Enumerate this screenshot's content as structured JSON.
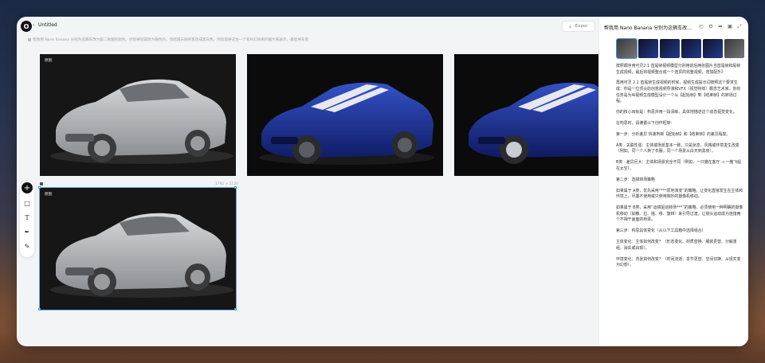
{
  "app": {
    "logo_text": "O",
    "doc_title": "Untitled",
    "export_label": "Expor",
    "prompt_text": "帮我用 Nano Banana 分别为这辆车改为第二张图的颜色，然后将轮毂改为银色的，然后再去除背景改成黑白色，然后再将这台一个有科幻效果的图片来表示，最后将车变"
  },
  "canvas": {
    "frame1_tag": "原图",
    "frame4_tag": "原图",
    "frame4_dims": "1792 × 1120"
  },
  "colors": {
    "accent": "#4a90e2",
    "car_gray": "#b9bcc0",
    "car_blue": "#1e3aa8"
  },
  "toolbar": {
    "tools": [
      "plus-icon",
      "square-icon",
      "text-icon",
      "pen-icon",
      "pencil-icon"
    ]
  },
  "panel": {
    "title": "帮我用 Nano Banana 分别为这辆车改为...",
    "icons": [
      "history-icon",
      "gear-icon",
      "share-icon",
      "image-icon",
      "collapse-icon"
    ],
    "paragraphs": [
      "按照顺序用可灵2.1 首尾帧视频模型分别用前后两张图片当首尾帧和尾帧生成视频，最后将视频整合成一个连贯的完整视频，增加配乐》",
      "再用可灵 2.1 首尾帧生成视频的时候，视频生成提示词按照这个要求生成：你是一位顶尖的创意视频导演和VFX（视觉特效）概念艺术家。你的任务是为AI视频生成模型设计一个从【起始帧】到【结束帧】的转场过程。",
      "你的核心目标是：构思并用一段清晰、具体地描述这个动态视觉变化。",
      "在构思时，请遵循以下创作框架：",
      "第一步：分析差异 快速判断【起始帧】和【结束帧】的差异程度。",
      "A类 · 关联性强：主体或场景基本一致，只是状态、风格或环境发生改变（例如，同一个人换了衣服，同一个场景从白天到黑夜）。",
      "B类 · 差异巨大：主体和场景完全不同（例如，一只猫在客厅 → 一艘飞船在太空）。",
      "第二步：选择转场策略",
      "如果属于 A类，优先采用“***原地演变”的策略。让变化直接发生在主体和环境上，尽量不使用或只使用微妙的摄像机移动。",
      "如果属于 B类，采用“运镜驱动转场***”的策略。必须使用一种明确的摄像机移动（如推、拉、摇、移、旋转）来引导过渡，让镜头运动成为连接两个不相干画面的桥梁。",
      "第三步：构思具体变化（从以下工具箱中选择组合）",
      "主体变化：主体如何改变？（形态变化、材质替换、服装更替、分解重组、消失或出现）。",
      "环境变化：背景如何改变？（时间流逝、季节更替、空间切换、从现实变为幻想）。"
    ]
  }
}
